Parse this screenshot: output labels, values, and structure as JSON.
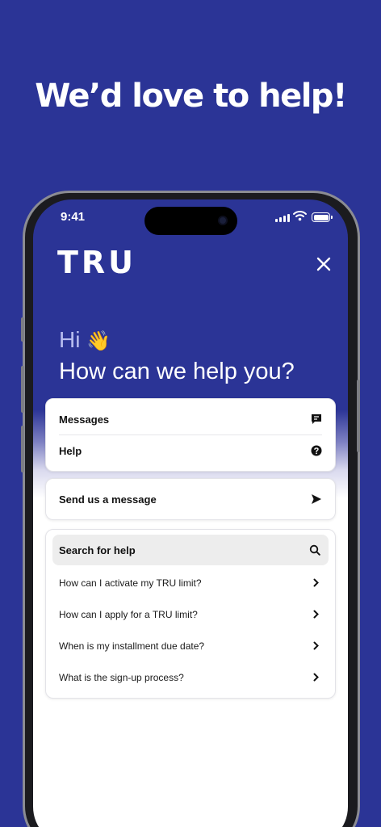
{
  "headline": "We’d love to help!",
  "status_bar": {
    "time": "9:41"
  },
  "app": {
    "logo": "TRU",
    "greeting": "Hi",
    "greeting_emoji": "👋",
    "title": "How can we help you?"
  },
  "menu": {
    "messages_label": "Messages",
    "help_label": "Help"
  },
  "send_message_label": "Send us a message",
  "search": {
    "label": "Search for help"
  },
  "questions": [
    "How can I activate my TRU limit?",
    "How can I apply for a TRU limit?",
    "When is my installment due date?",
    "What is the sign-up process?"
  ],
  "colors": {
    "brand": "#2b3496",
    "card": "#ffffff",
    "search_bg": "#ededed"
  },
  "icons": [
    "close-icon",
    "message-icon",
    "help-icon",
    "send-icon",
    "search-icon",
    "chevron-right-icon"
  ]
}
